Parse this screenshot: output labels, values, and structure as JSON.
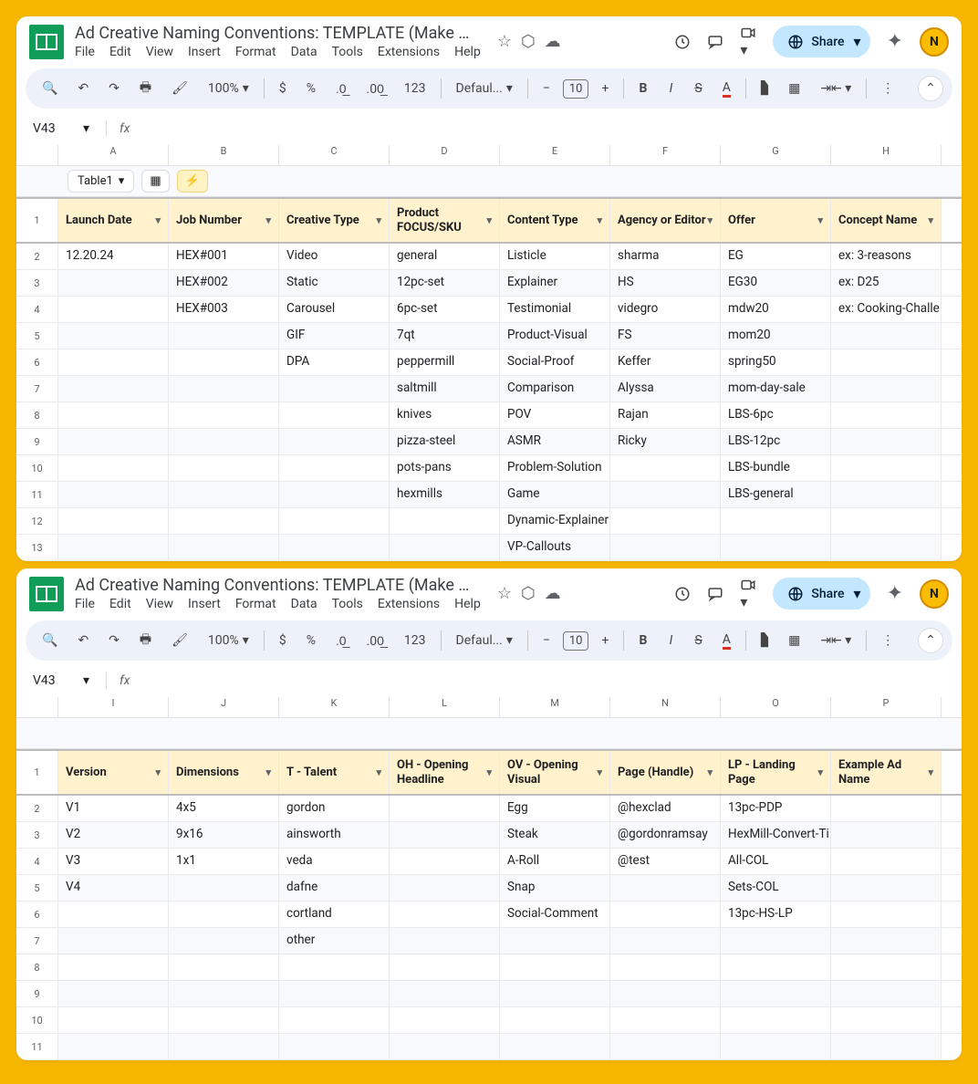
{
  "frame": {
    "bg": "#f6b600"
  },
  "doc": {
    "title": "Ad Creative Naming Conventions: TEMPLATE (Make a C...",
    "menus": [
      "File",
      "Edit",
      "View",
      "Insert",
      "Format",
      "Data",
      "Tools",
      "Extensions",
      "Help"
    ]
  },
  "toolbar": {
    "zoom": "100%",
    "font": "Defaul...",
    "size": "10"
  },
  "namebox": {
    "cell": "V43"
  },
  "share": {
    "label": "Share"
  },
  "avatar": {
    "letter": "N"
  },
  "sheet1": {
    "cols": [
      "A",
      "B",
      "C",
      "D",
      "E",
      "F",
      "G",
      "H"
    ],
    "tab_label": "Table1",
    "headers": [
      "Launch Date",
      "Job Number",
      "Creative Type",
      "Product FOCUS/SKU",
      "Content Type",
      "Agency or Editor",
      "Offer",
      "Concept Name"
    ],
    "rows": [
      [
        "12.20.24",
        "HEX#001",
        "Video",
        "general",
        "Listicle",
        "sharma",
        "EG",
        "ex: 3-reasons"
      ],
      [
        "",
        "HEX#002",
        "Static",
        "12pc-set",
        "Explainer",
        "HS",
        "EG30",
        "ex: D25"
      ],
      [
        "",
        "HEX#003",
        "Carousel",
        "6pc-set",
        "Testimonial",
        "videgro",
        "mdw20",
        "ex: Cooking-Challe"
      ],
      [
        "",
        "",
        "GIF",
        "7qt",
        "Product-Visual",
        "FS",
        "mom20",
        ""
      ],
      [
        "",
        "",
        "DPA",
        "peppermill",
        "Social-Proof",
        "Keffer",
        "spring50",
        ""
      ],
      [
        "",
        "",
        "",
        "saltmill",
        "Comparison",
        "Alyssa",
        "mom-day-sale",
        ""
      ],
      [
        "",
        "",
        "",
        "knives",
        "POV",
        "Rajan",
        "LBS-6pc",
        ""
      ],
      [
        "",
        "",
        "",
        "pizza-steel",
        "ASMR",
        "Ricky",
        "LBS-12pc",
        ""
      ],
      [
        "",
        "",
        "",
        "pots-pans",
        "Problem-Solution",
        "",
        "LBS-bundle",
        ""
      ],
      [
        "",
        "",
        "",
        "hexmills",
        "Game",
        "",
        "LBS-general",
        ""
      ],
      [
        "",
        "",
        "",
        "",
        "Dynamic-Explainer",
        "",
        "",
        ""
      ],
      [
        "",
        "",
        "",
        "",
        "VP-Callouts",
        "",
        "",
        ""
      ]
    ]
  },
  "sheet2": {
    "cols": [
      "I",
      "J",
      "K",
      "L",
      "M",
      "N",
      "O",
      "P"
    ],
    "headers": [
      "Version",
      "Dimensions",
      "T - Talent",
      "OH - Opening Headline",
      "OV - Opening Visual",
      "Page (Handle)",
      "LP - Landing Page",
      "Example Ad Name"
    ],
    "rows": [
      [
        "V1",
        "4x5",
        "gordon",
        "",
        "Egg",
        "@hexclad",
        "13pc-PDP",
        ""
      ],
      [
        "V2",
        "9x16",
        "ainsworth",
        "",
        "Steak",
        "@gordonramsay",
        "HexMill-Convert-Ti",
        ""
      ],
      [
        "V3",
        "1x1",
        "veda",
        "",
        "A-Roll",
        "@test",
        "All-COL",
        ""
      ],
      [
        "V4",
        "",
        "dafne",
        "",
        "Snap",
        "",
        "Sets-COL",
        ""
      ],
      [
        "",
        "",
        "cortland",
        "",
        "Social-Comment",
        "",
        "13pc-HS-LP",
        ""
      ],
      [
        "",
        "",
        "other",
        "",
        "",
        "",
        "",
        ""
      ],
      [
        "",
        "",
        "",
        "",
        "",
        "",
        "",
        ""
      ],
      [
        "",
        "",
        "",
        "",
        "",
        "",
        "",
        ""
      ],
      [
        "",
        "",
        "",
        "",
        "",
        "",
        "",
        ""
      ],
      [
        "",
        "",
        "",
        "",
        "",
        "",
        "",
        ""
      ]
    ]
  }
}
